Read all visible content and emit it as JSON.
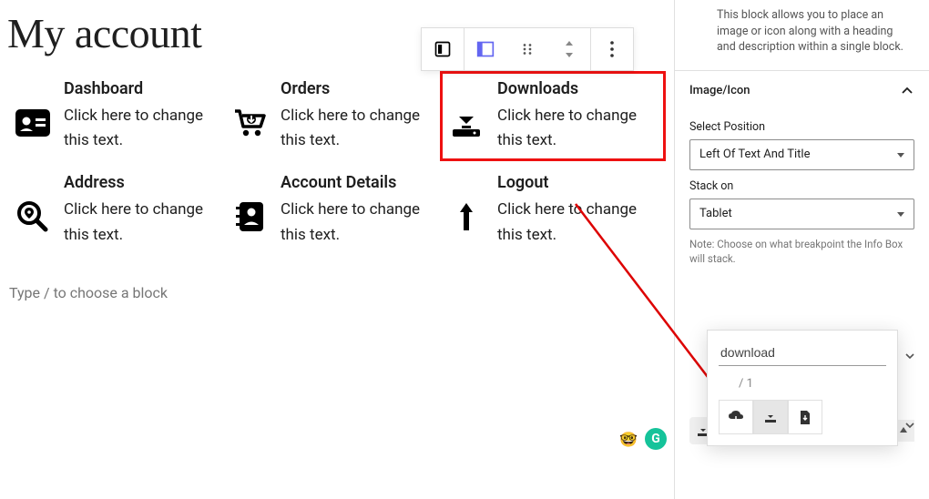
{
  "page": {
    "title": "My account"
  },
  "items": [
    {
      "title": "Dashboard",
      "text": "Click here to change this text.",
      "icon": "id-card"
    },
    {
      "title": "Orders",
      "text": "Click here to change this text.",
      "icon": "cart"
    },
    {
      "title": "Downloads",
      "text": "Click here to change this text.",
      "icon": "download",
      "selected": true
    },
    {
      "title": "Address",
      "text": "Click here to change this text.",
      "icon": "search-loc"
    },
    {
      "title": "Account Details",
      "text": "Click here to change this text.",
      "icon": "contacts"
    },
    {
      "title": "Logout",
      "text": "Click here to change this text.",
      "icon": "arrow-up"
    }
  ],
  "placeholder": "Type / to choose a block",
  "sidebar": {
    "block_desc": "This block allows you to place an image or icon along with a heading and description within a single block.",
    "panel_title": "Image/Icon",
    "pos_label": "Select Position",
    "pos_value": "Left Of Text And Title",
    "stack_label": "Stack on",
    "stack_value": "Tablet",
    "stack_note": "Note: Choose on what breakpoint the Info Box will stack."
  },
  "icon_search": {
    "query": "download",
    "page_indicator": "/  1"
  }
}
